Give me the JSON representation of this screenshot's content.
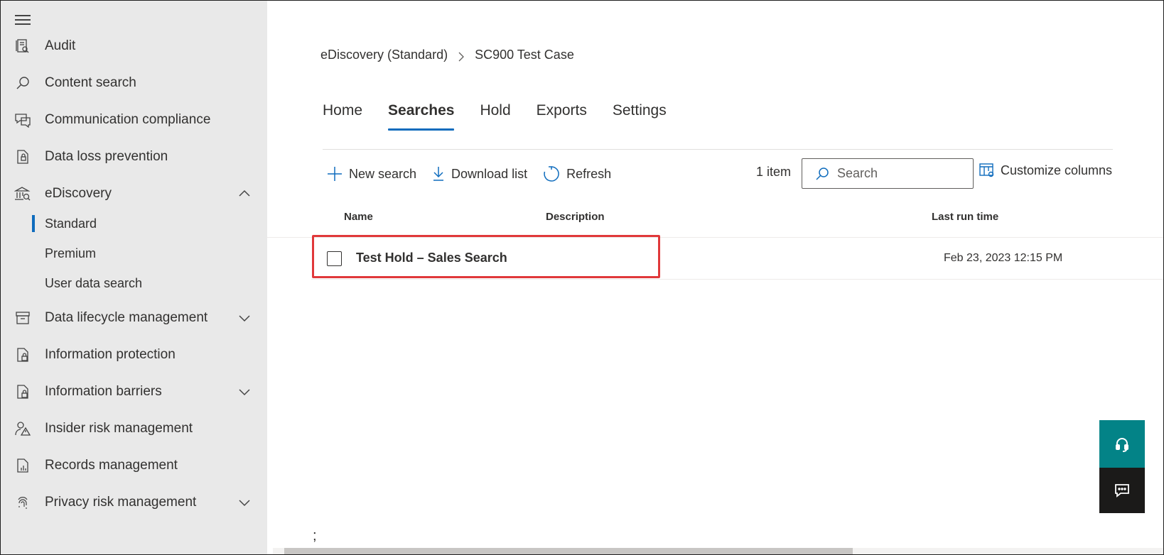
{
  "sidebar": {
    "items": [
      {
        "label": "Audit",
        "icon": "audit-icon"
      },
      {
        "label": "Content search",
        "icon": "search-icon"
      },
      {
        "label": "Communication compliance",
        "icon": "chat-icon"
      },
      {
        "label": "Data loss prevention",
        "icon": "dlp-icon"
      },
      {
        "label": "eDiscovery",
        "icon": "building-icon",
        "expanded": true
      },
      {
        "label": "Data lifecycle management",
        "icon": "archive-icon"
      },
      {
        "label": "Information protection",
        "icon": "document-lock-icon"
      },
      {
        "label": "Information barriers",
        "icon": "document-lock-icon"
      },
      {
        "label": "Insider risk management",
        "icon": "person-warning-icon"
      },
      {
        "label": "Records management",
        "icon": "document-chart-icon"
      },
      {
        "label": "Privacy risk management",
        "icon": "fingerprint-icon"
      }
    ],
    "ediscovery_sub": [
      {
        "label": "Standard",
        "selected": true
      },
      {
        "label": "Premium"
      },
      {
        "label": "User data search"
      }
    ]
  },
  "breadcrumb": {
    "parent": "eDiscovery (Standard)",
    "current": "SC900 Test Case"
  },
  "tabs": [
    {
      "label": "Home"
    },
    {
      "label": "Searches",
      "active": true
    },
    {
      "label": "Hold"
    },
    {
      "label": "Exports"
    },
    {
      "label": "Settings"
    }
  ],
  "toolbar": {
    "new_search": "New search",
    "download_list": "Download list",
    "refresh": "Refresh",
    "count": "1 item",
    "search_placeholder": "Search",
    "customize_columns": "Customize columns"
  },
  "table": {
    "columns": [
      "Name",
      "Description",
      "Last run time"
    ],
    "rows": [
      {
        "name": "Test Hold – Sales Search",
        "description": "",
        "last_run": "Feb 23, 2023 12:15 PM"
      }
    ]
  },
  "stray_text": ";",
  "colors": {
    "accent": "#0f6cbd",
    "highlight": "#e0383a",
    "help": "#038387",
    "feedback": "#1b1a19"
  }
}
